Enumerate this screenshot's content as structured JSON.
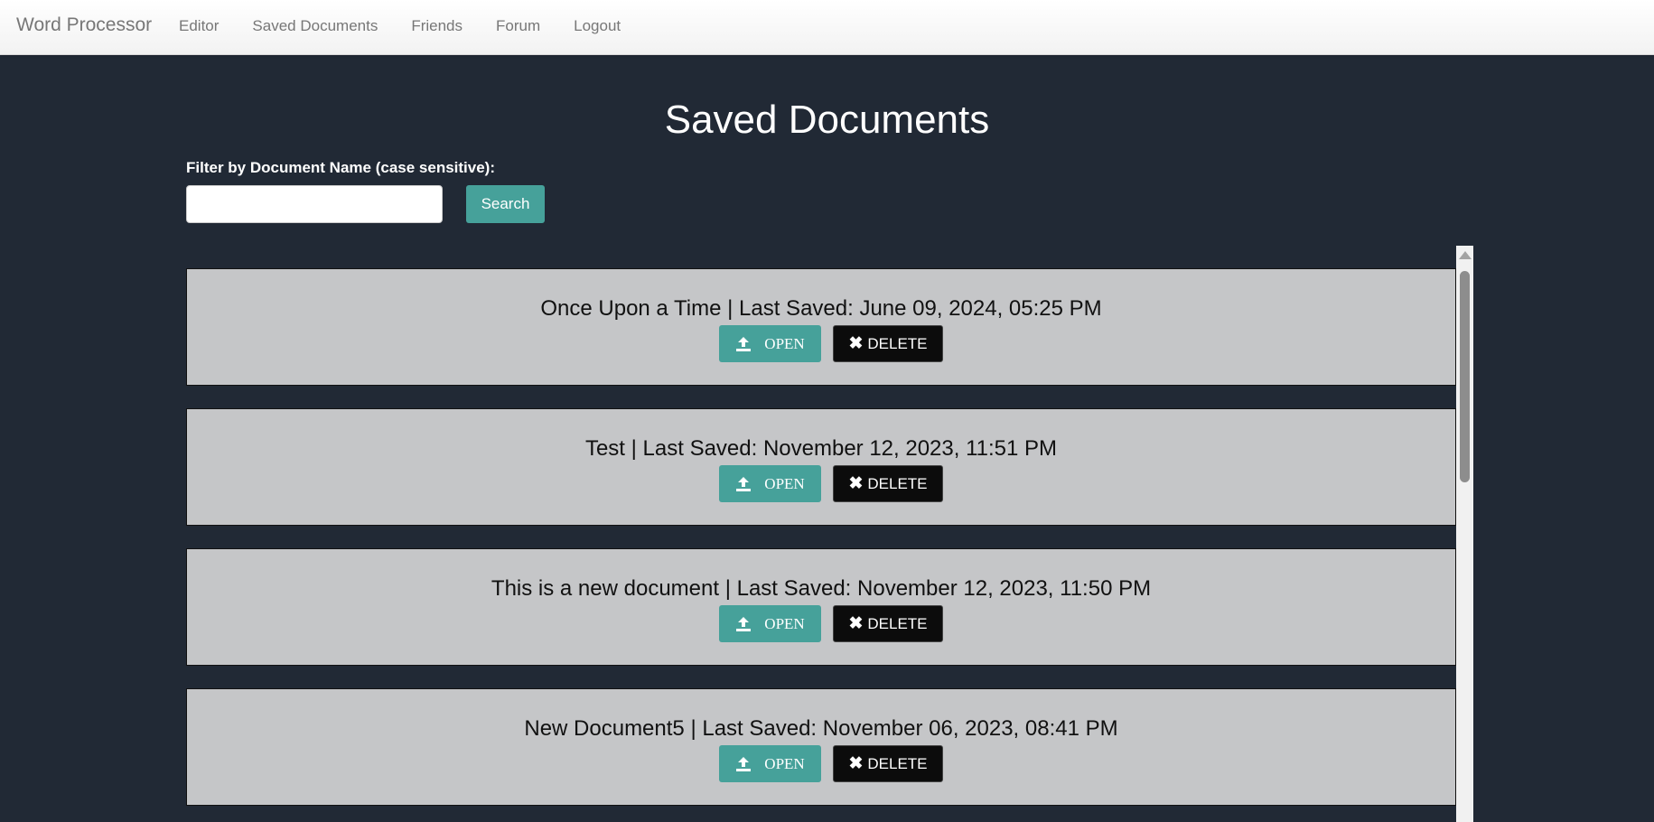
{
  "navbar": {
    "brand": "Word Processor",
    "links": [
      "Editor",
      "Saved Documents",
      "Friends",
      "Forum",
      "Logout"
    ]
  },
  "page": {
    "title": "Saved Documents",
    "filter_label": "Filter by Document Name (case sensitive):",
    "filter_value": "",
    "search_label": "Search"
  },
  "documents": [
    {
      "title": "Once Upon a Time | Last Saved: June 09, 2024, 05:25 PM",
      "open_label": "OPEN",
      "delete_label": "DELETE"
    },
    {
      "title": "Test | Last Saved: November 12, 2023, 11:51 PM",
      "open_label": "OPEN",
      "delete_label": "DELETE"
    },
    {
      "title": "This is a new document | Last Saved: November 12, 2023, 11:50 PM",
      "open_label": "OPEN",
      "delete_label": "DELETE"
    },
    {
      "title": "New Document5 | Last Saved: November 06, 2023, 08:41 PM",
      "open_label": "OPEN",
      "delete_label": "DELETE"
    }
  ],
  "icons": {
    "open": "upload-icon",
    "delete": "close-icon"
  },
  "colors": {
    "background": "#212935",
    "accent": "#46a19a",
    "card": "#c5c6c8",
    "delete": "#0c0c0c"
  }
}
